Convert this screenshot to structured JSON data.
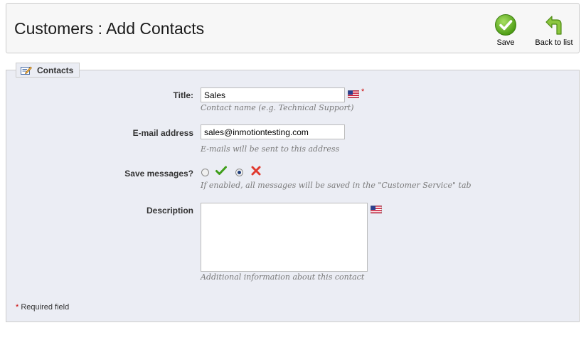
{
  "toolbar": {
    "title": "Customers : Add Contacts",
    "save_label": "Save",
    "back_label": "Back to list"
  },
  "form": {
    "legend": "Contacts",
    "title_field": {
      "label": "Title:",
      "value": "Sales",
      "hint": "Contact name (e.g. Technical Support)",
      "required_mark": "*"
    },
    "email_field": {
      "label": "E-mail address",
      "value": "sales@inmotiontesting.com",
      "hint": "E-mails will be sent to this address"
    },
    "save_messages": {
      "label": "Save messages?",
      "selected": "no",
      "hint": "If enabled, all messages will be saved in the \"Customer Service\" tab"
    },
    "description_field": {
      "label": "Description",
      "value": "",
      "hint": "Additional information about this contact"
    },
    "required_note": {
      "star": "*",
      "text": " Required field"
    }
  },
  "icons": {
    "save": "checkmark-circle-icon",
    "back": "return-arrow-icon",
    "legend": "edit-note-icon",
    "language": "us-flag-icon",
    "yes": "green-check-icon",
    "no": "red-x-icon"
  },
  "colors": {
    "panel_bg": "#ebedf4",
    "save_green": "#5aaa1e",
    "required": "#cc0000"
  }
}
